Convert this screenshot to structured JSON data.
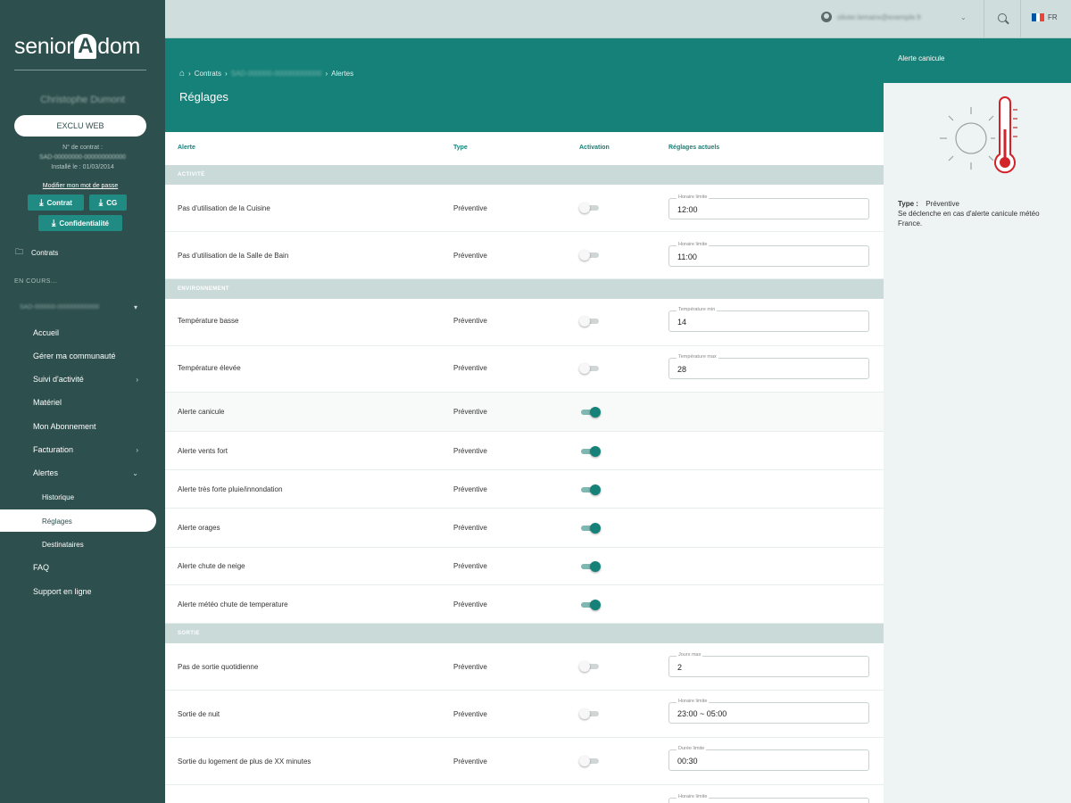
{
  "sidebar": {
    "brand_left": "senior",
    "brand_a": "A",
    "brand_right": "dom",
    "client_name": "Christophe Dumont",
    "exclu_label": "EXCLU WEB",
    "contract_no_label": "N° de contrat :",
    "contract_ref": "SAD-00000000-000000000000",
    "install_date": "Installé le : 01/03/2014",
    "modify_link": "Modifier mon mot de passe",
    "downloads": [
      {
        "label": "Contrat"
      },
      {
        "label": "CG"
      },
      {
        "label": "Confidentialité"
      }
    ],
    "contrats_label": "Contrats",
    "en_cours_label": "EN COURS...",
    "current_contract": "SAD-000000-000000000000",
    "nav": [
      {
        "label": "Accueil",
        "level": 0
      },
      {
        "label": "Gérer ma communauté",
        "level": 0
      },
      {
        "label": "Suivi d'activité",
        "level": 0,
        "chevron": "›"
      },
      {
        "label": "Matériel",
        "level": 0
      },
      {
        "label": "Mon Abonnement",
        "level": 0
      },
      {
        "label": "Facturation",
        "level": 0,
        "chevron": "›"
      },
      {
        "label": "Alertes",
        "level": 0,
        "chevron": "⌄"
      },
      {
        "label": "Historique",
        "level": 1
      },
      {
        "label": "Réglages",
        "level": 1,
        "active": true
      },
      {
        "label": "Destinataires",
        "level": 1
      },
      {
        "label": "FAQ",
        "level": 0
      },
      {
        "label": "Support en ligne",
        "level": 0
      }
    ]
  },
  "topbar": {
    "user_email": "olivier.lemaire@exemple.fr",
    "lang": "FR"
  },
  "header": {
    "breadcrumb_contracts": "Contrats",
    "breadcrumb_contract": "SAD-000000-000000000000",
    "breadcrumb_current": "Alertes",
    "title": "Réglages"
  },
  "table": {
    "columns": [
      "Alerte",
      "Type",
      "Activation",
      "Réglages actuels"
    ],
    "sections": [
      {
        "label": "ACTIVITÉ",
        "rows": [
          {
            "alert": "Pas d'utilisation de la Cuisine",
            "type": "Préventive",
            "active": false,
            "field_label": "Horaire limite",
            "field_value": "12:00"
          },
          {
            "alert": "Pas d'utilisation de la Salle de Bain",
            "type": "Préventive",
            "active": false,
            "field_label": "Horaire limite",
            "field_value": "11:00"
          }
        ]
      },
      {
        "label": "ENVIRONNEMENT",
        "rows": [
          {
            "alert": "Température basse",
            "type": "Préventive",
            "active": false,
            "field_label": "Température min",
            "field_value": "14"
          },
          {
            "alert": "Température élevée",
            "type": "Préventive",
            "active": false,
            "field_label": "Température max",
            "field_value": "28"
          },
          {
            "alert": "Alerte canicule",
            "type": "Préventive",
            "active": true
          },
          {
            "alert": "Alerte vents fort",
            "type": "Préventive",
            "active": true
          },
          {
            "alert": "Alerte très forte pluie/innondation",
            "type": "Préventive",
            "active": true
          },
          {
            "alert": "Alerte orages",
            "type": "Préventive",
            "active": true
          },
          {
            "alert": "Alerte chute de neige",
            "type": "Préventive",
            "active": true
          },
          {
            "alert": "Alerte météo chute de temperature",
            "type": "Préventive",
            "active": true
          }
        ]
      },
      {
        "label": "SORTIE",
        "rows": [
          {
            "alert": "Pas de sortie quotidienne",
            "type": "Préventive",
            "active": false,
            "field_label": "Jours max",
            "field_value": "2"
          },
          {
            "alert": "Sortie de nuit",
            "type": "Préventive",
            "active": false,
            "field_label": "Horaire limite",
            "field_value": "23:00 ~ 05:00"
          },
          {
            "alert": "Sortie du logement de plus de XX minutes",
            "type": "Préventive",
            "active": false,
            "field_label": "Durée limite",
            "field_value": "00:30"
          },
          {
            "alert": "",
            "type": "",
            "active": null,
            "field_label": "Horaire limite",
            "field_value": ""
          }
        ]
      }
    ]
  },
  "panel": {
    "title": "Alerte canicule",
    "type_label": "Type :",
    "type_value": "Préventive",
    "description": "Se déclenche en cas d'alerte canicule météo France.",
    "illustration": "sun-thermometer-icon"
  },
  "colors": {
    "sidebar_bg": "#2d4f4d",
    "accent": "#168178",
    "section_bg": "#c9dad8",
    "thermometer": "#d2232a"
  }
}
